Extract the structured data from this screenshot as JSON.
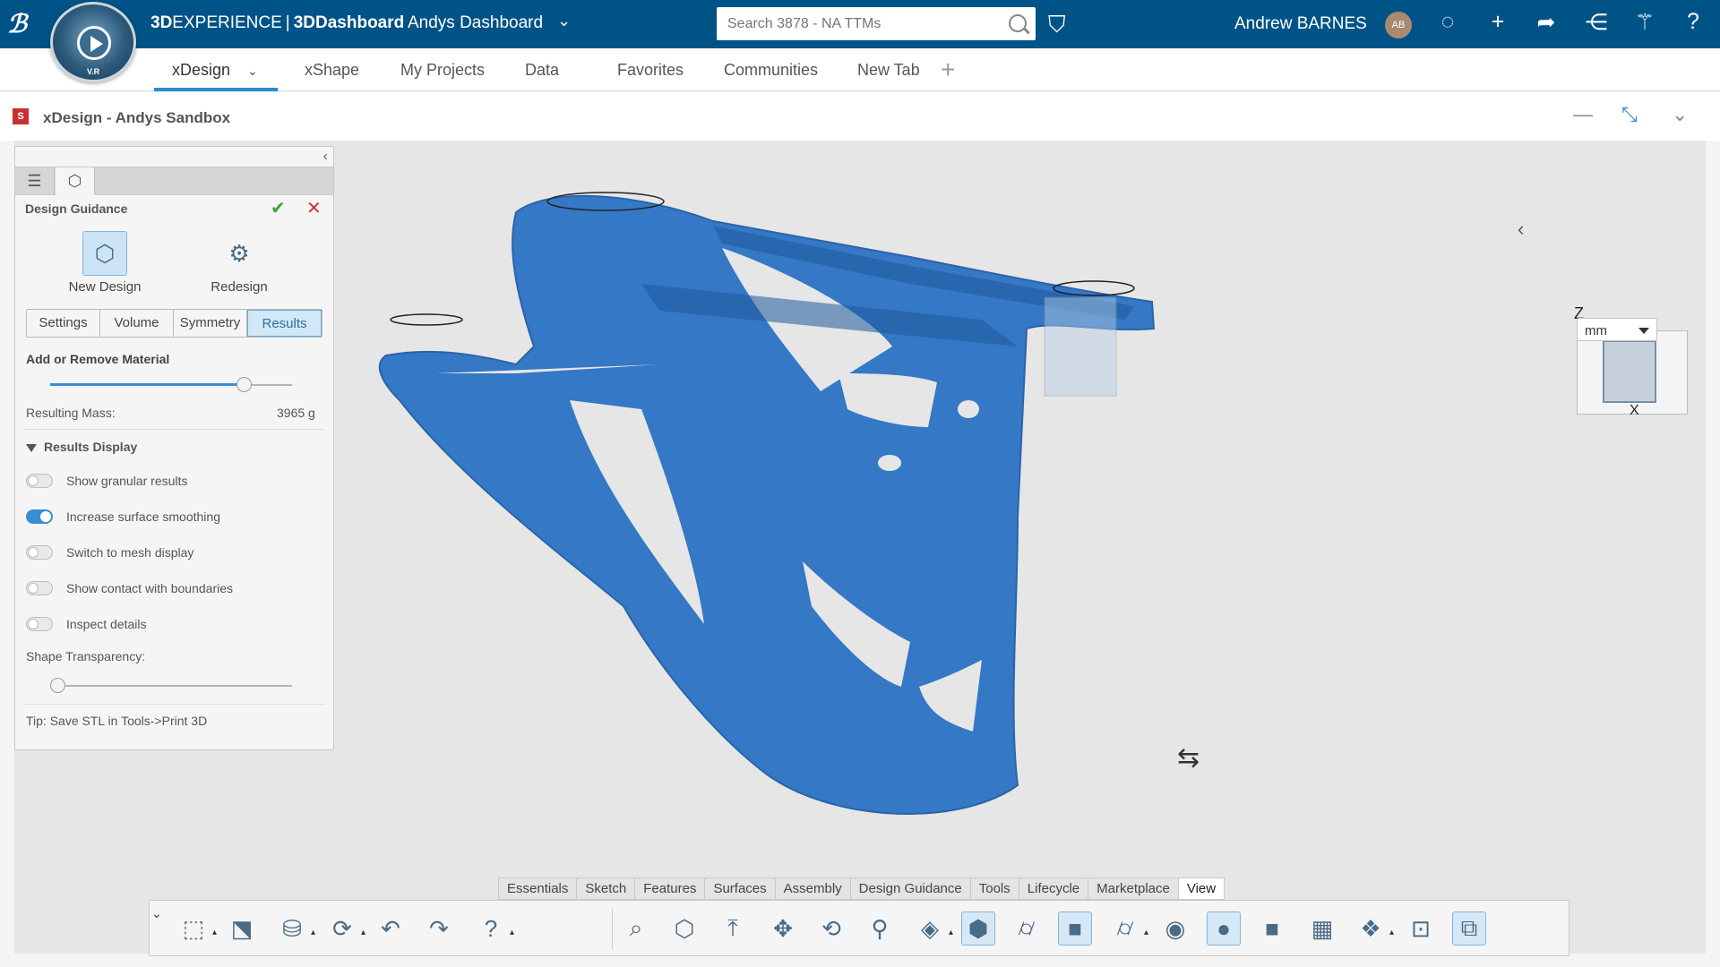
{
  "topbar": {
    "brand_prefix": "3D",
    "brand_mid": "EXPERIENCE",
    "brand_sep": "|",
    "brand_app": "3DDashboard",
    "dashboard_name": "Andys Dashboard",
    "search_placeholder": "Search 3878 - NA TTMs",
    "user_name": "Andrew BARNES",
    "user_initials": "AB",
    "compass_label": "V.R"
  },
  "tabs": [
    {
      "label": "xDesign"
    },
    {
      "label": "xShape"
    },
    {
      "label": "My Projects"
    },
    {
      "label": "Data"
    },
    {
      "label": "Favorites"
    },
    {
      "label": "Communities"
    },
    {
      "label": "New Tab"
    }
  ],
  "app": {
    "title": "xDesign - Andys Sandbox",
    "icon_letter": "S"
  },
  "panel": {
    "section_title": "Design Guidance",
    "new_design_label": "New Design",
    "redesign_label": "Redesign",
    "segments": [
      "Settings",
      "Volume",
      "Symmetry",
      "Results"
    ],
    "selected_segment": "Results",
    "material_label": "Add or Remove Material",
    "material_slider_value": 0.8,
    "mass_label": "Resulting Mass:",
    "mass_value": "3965 g",
    "results_display_label": "Results Display",
    "toggles": [
      {
        "label": "Show granular results",
        "on": false
      },
      {
        "label": "Increase surface smoothing",
        "on": true
      },
      {
        "label": "Switch to mesh display",
        "on": false
      },
      {
        "label": "Show contact with boundaries",
        "on": false
      },
      {
        "label": "Inspect details",
        "on": false
      }
    ],
    "transparency_label": "Shape Transparency:",
    "transparency_value": 0,
    "tip": "Tip: Save STL in Tools->Print 3D"
  },
  "viewport": {
    "axis_z": "Z",
    "axis_x": "X",
    "unit": "mm",
    "model_color": "#3478c6"
  },
  "action_bar": {
    "tabs": [
      "Essentials",
      "Sketch",
      "Features",
      "Surfaces",
      "Assembly",
      "Design Guidance",
      "Tools",
      "Lifecycle",
      "Marketplace",
      "View"
    ],
    "selected": "View"
  },
  "toolbar": {
    "icons": [
      "new-part-icon",
      "open-icon",
      "save-icon",
      "update-icon",
      "undo-icon",
      "redo-icon",
      "help-icon",
      "zoom-fit-icon",
      "box-icon",
      "normal-view-icon",
      "pan-icon",
      "rotate-icon",
      "zoom-icon",
      "render-style-icon",
      "shaded-icon",
      "cylinder-icon",
      "shaded-edges-icon",
      "wireframe-cylinder-icon",
      "hide-show-icon",
      "ambient-occlusion-icon",
      "grey-cube-icon",
      "grid-icon",
      "explode-icon",
      "capture-icon",
      "section-icon"
    ]
  }
}
